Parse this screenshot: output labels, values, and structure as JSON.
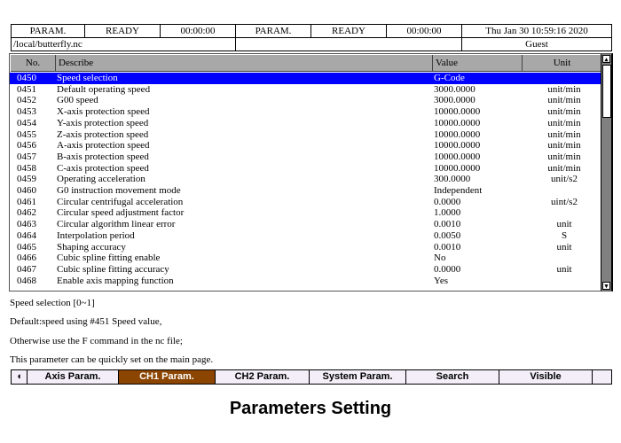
{
  "status": {
    "mode1": "PARAM.",
    "state1": "READY",
    "time1": "00:00:00",
    "mode2": "PARAM.",
    "state2": "READY",
    "time2": "00:00:00",
    "datetime": "Thu Jan 30 10:59:16 2020",
    "file": "/local/butterfly.nc",
    "user": "Guest"
  },
  "table": {
    "headers": {
      "no": "No.",
      "describe": "Describe",
      "value": "Value",
      "unit": "Unit"
    },
    "rows": [
      {
        "no": "0450",
        "desc": "Speed selection",
        "value": "G-Code",
        "unit": ""
      },
      {
        "no": "0451",
        "desc": "Default operating speed",
        "value": "3000.0000",
        "unit": "unit/min"
      },
      {
        "no": "0452",
        "desc": "G00 speed",
        "value": "3000.0000",
        "unit": "unit/min"
      },
      {
        "no": "0453",
        "desc": "X-axis protection speed",
        "value": "10000.0000",
        "unit": "unit/min"
      },
      {
        "no": "0454",
        "desc": "Y-axis protection speed",
        "value": "10000.0000",
        "unit": "unit/min"
      },
      {
        "no": "0455",
        "desc": "Z-axis protection speed",
        "value": "10000.0000",
        "unit": "unit/min"
      },
      {
        "no": "0456",
        "desc": "A-axis protection speed",
        "value": "10000.0000",
        "unit": "unit/min"
      },
      {
        "no": "0457",
        "desc": "B-axis protection speed",
        "value": "10000.0000",
        "unit": "unit/min"
      },
      {
        "no": "0458",
        "desc": "C-axis protection speed",
        "value": "10000.0000",
        "unit": "unit/min"
      },
      {
        "no": "0459",
        "desc": "Operating acceleration",
        "value": "300.0000",
        "unit": "unit/s2"
      },
      {
        "no": "0460",
        "desc": "G0 instruction movement mode",
        "value": "Independent",
        "unit": ""
      },
      {
        "no": "0461",
        "desc": "Circular centrifugal acceleration",
        "value": "0.0000",
        "unit": "uint/s2"
      },
      {
        "no": "0462",
        "desc": "Circular speed adjustment factor",
        "value": "1.0000",
        "unit": ""
      },
      {
        "no": "0463",
        "desc": "Circular algorithm linear error",
        "value": "0.0010",
        "unit": "unit"
      },
      {
        "no": "0464",
        "desc": "Interpolation period",
        "value": "0.0050",
        "unit": "S"
      },
      {
        "no": "0465",
        "desc": "Shaping accuracy",
        "value": "0.0010",
        "unit": "unit"
      },
      {
        "no": "0466",
        "desc": "Cubic spline fitting enable",
        "value": "No",
        "unit": ""
      },
      {
        "no": "0467",
        "desc": "Cubic spline fitting accuracy",
        "value": "0.0000",
        "unit": "unit"
      },
      {
        "no": "0468",
        "desc": "Enable axis mapping function",
        "value": "Yes",
        "unit": ""
      }
    ]
  },
  "description": [
    "Speed selection [0~1]",
    "Default:speed using #451 Speed value,",
    "Otherwise use the F command in the nc file;",
    "This parameter can be quickly set on the main page."
  ],
  "buttons": [
    "Axis Param.",
    "CH1 Param.",
    "CH2 Param.",
    "System Param.",
    "Search",
    "Visible"
  ],
  "active_button": 1,
  "caption": "Parameters Setting",
  "colors": {
    "selected_row": "#0000ff",
    "active_button": "#8b4500",
    "header": "#a8a8a8"
  }
}
